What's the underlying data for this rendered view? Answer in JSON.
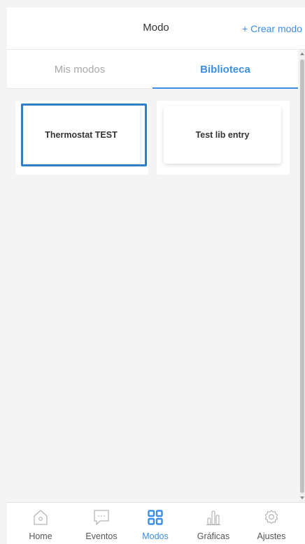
{
  "header": {
    "title": "Modo",
    "create_label": "+ Crear modo"
  },
  "tabs": [
    {
      "label": "Mis modos",
      "active": false
    },
    {
      "label": "Biblioteca",
      "active": true
    }
  ],
  "cards": [
    {
      "label": "Thermostat TEST",
      "selected": true
    },
    {
      "label": "Test lib entry",
      "selected": false
    }
  ],
  "nav": [
    {
      "label": "Home",
      "icon": "home-icon",
      "active": false
    },
    {
      "label": "Eventos",
      "icon": "chat-bubble-icon",
      "active": false
    },
    {
      "label": "Modos",
      "icon": "grid-icon",
      "active": true
    },
    {
      "label": "Gráficas",
      "icon": "bar-chart-icon",
      "active": false
    },
    {
      "label": "Ajustes",
      "icon": "gear-icon",
      "active": false
    }
  ],
  "colors": {
    "accent": "#3a8ee6",
    "selection_outline": "#2f7fc4",
    "background": "#f4f4f4",
    "inactive_icon": "#b5b5b5"
  }
}
